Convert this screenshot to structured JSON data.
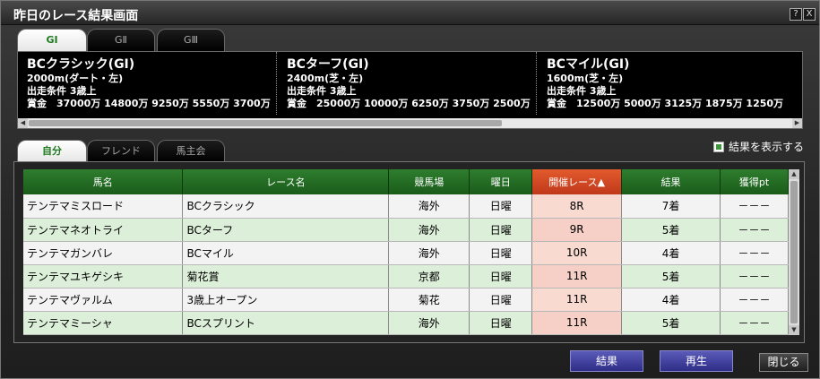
{
  "window": {
    "title": "昨日のレース結果画面",
    "help_label": "?",
    "close_label": "X"
  },
  "grade_tabs": [
    {
      "label": "GⅠ",
      "active": true
    },
    {
      "label": "GⅡ",
      "active": false
    },
    {
      "label": "GⅢ",
      "active": false
    }
  ],
  "races": [
    {
      "title": "BCクラシック(GⅠ)",
      "distance": "2000m(ダート・左)",
      "condition": "出走条件 3歳上",
      "prize": "賞金　37000万 14800万 9250万 5550万 3700万"
    },
    {
      "title": "BCターフ(GⅠ)",
      "distance": "2400m(芝・左)",
      "condition": "出走条件 3歳上",
      "prize": "賞金　25000万 10000万 6250万 3750万 2500万"
    },
    {
      "title": "BCマイル(GⅠ)",
      "distance": "1600m(芝・左)",
      "condition": "出走条件 3歳上",
      "prize": "賞金　12500万 5000万 3125万 1875万 1250万"
    }
  ],
  "owner_tabs": [
    {
      "label": "自分",
      "active": true
    },
    {
      "label": "フレンド",
      "active": false
    },
    {
      "label": "馬主会",
      "active": false
    }
  ],
  "show_results": {
    "label": "結果を表示する",
    "checked": true
  },
  "table": {
    "columns": [
      "馬名",
      "レース名",
      "競馬場",
      "曜日",
      "開催レース▲",
      "結果",
      "獲得pt"
    ],
    "sorted_column": 4,
    "rows": [
      [
        "テンテマミスロード",
        "BCクラシック",
        "海外",
        "日曜",
        "8R",
        "7着",
        "－－－"
      ],
      [
        "テンテマネオトライ",
        "BCターフ",
        "海外",
        "日曜",
        "9R",
        "5着",
        "－－－"
      ],
      [
        "テンテマガンバレ",
        "BCマイル",
        "海外",
        "日曜",
        "10R",
        "4着",
        "－－－"
      ],
      [
        "テンテマユキゲシキ",
        "菊花賞",
        "京都",
        "日曜",
        "11R",
        "5着",
        "－－－"
      ],
      [
        "テンテマヴァルム",
        "3歳上オープン",
        "菊花",
        "日曜",
        "11R",
        "4着",
        "－－－"
      ],
      [
        "テンテマミーシャ",
        "BCスプリント",
        "海外",
        "日曜",
        "11R",
        "5着",
        "－－－"
      ]
    ]
  },
  "buttons": {
    "result": "結果",
    "replay": "再生",
    "close": "閉じる"
  },
  "colors": {
    "header_green": "#2e7d2e",
    "sorted_header": "#e35a2d",
    "row_green": "#dcefd9",
    "button_blue": "#3d3d9e"
  }
}
